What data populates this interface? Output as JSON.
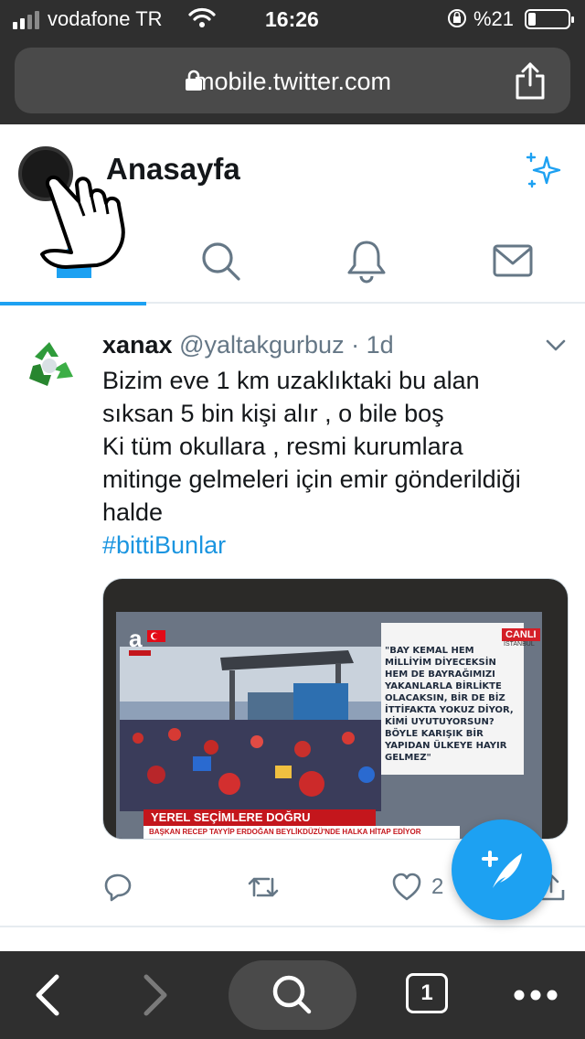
{
  "status_bar": {
    "carrier": "vodafone TR",
    "time": "16:26",
    "battery_percent": "%21",
    "battery_level": 0.21,
    "signal_bars": 2
  },
  "browser": {
    "url": "mobile.twitter.com",
    "open_tabs": "1"
  },
  "header": {
    "title": "Anasayfa",
    "active_tab": "home"
  },
  "tweet": {
    "name": "xanax",
    "handle": "@yaltakgurbuz",
    "separator": "·",
    "time": "1d",
    "text_lines": [
      "Bizim eve 1 km uzaklıktaki bu alan",
      "sıksan 5 bin kişi alır , o bile boş",
      "Ki tüm okullara , resmi kurumlara",
      "mitinge gelmeleri için emir gönderildiği",
      "halde"
    ],
    "hashtag": "#bittiBunlar",
    "media": {
      "live_badge": "CANLI",
      "location": "İSTANBUL",
      "quote": "\"BAY KEMAL HEM MİLLİYİM DİYECEKSİN HEM DE BAYRAĞIMIZI YAKANLARLA BİRLİKTE OLACAKSIN, BİR DE BİZ İTTİFAKTA YOKUZ DİYOR, KİMİ UYUTUYORSUN? BÖYLE KARIŞIK BİR YAPIDAN ÜLKEYE HAYIR GELMEZ\"",
      "ticker_title": "YEREL SEÇİMLERE DOĞRU",
      "ticker_subtitle": "BAŞKAN RECEP TAYYİP ERDOĞAN  BEYLİKDÜZÜ'NDE HALKA HİTAP EDİYOR",
      "channel": "a HABER"
    },
    "like_count": "2"
  },
  "colors": {
    "twitter_blue": "#1da1f2",
    "link_blue": "#1b95e0",
    "secondary_text": "#657786",
    "browser_chrome": "#2f2f2f"
  }
}
